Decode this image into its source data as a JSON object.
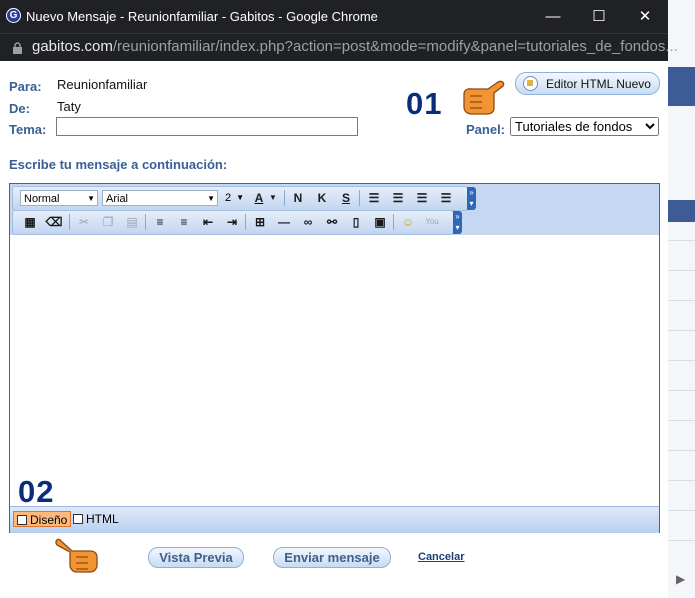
{
  "window": {
    "title": "Nuevo Mensaje - Reunionfamiliar - Gabitos - Google Chrome",
    "url_host": "gabitos.com",
    "url_path": "/reunionfamiliar/index.php?action=post&mode=modify&panel=tutoriales_de_fondos...",
    "minimize": "—",
    "maximize": "☐",
    "close": "✕"
  },
  "form": {
    "para_label": "Para:",
    "para_value": "Reunionfamiliar",
    "de_label": "De:",
    "de_value": "Taty",
    "tema_label": "Tema:",
    "tema_value": "",
    "panel_label": "Panel:",
    "panel_selected": "Tutoriales de fondos",
    "editor_button": "Editor HTML Nuevo",
    "instructions": "Escribe tu mensaje a continuación:"
  },
  "toolbar": {
    "style_value": "Normal",
    "font_value": "Arial",
    "size_value": "2",
    "color_label": "A",
    "bold": "N",
    "italic": "K",
    "strike": "S",
    "youtube_label": "You"
  },
  "editor": {
    "content": "",
    "tab_design": "Diseño",
    "tab_html": "HTML"
  },
  "annotations": {
    "step1": "01",
    "step2": "02"
  },
  "buttons": {
    "preview": "Vista Previa",
    "send": "Enviar mensaje",
    "cancel": "Cancelar"
  }
}
